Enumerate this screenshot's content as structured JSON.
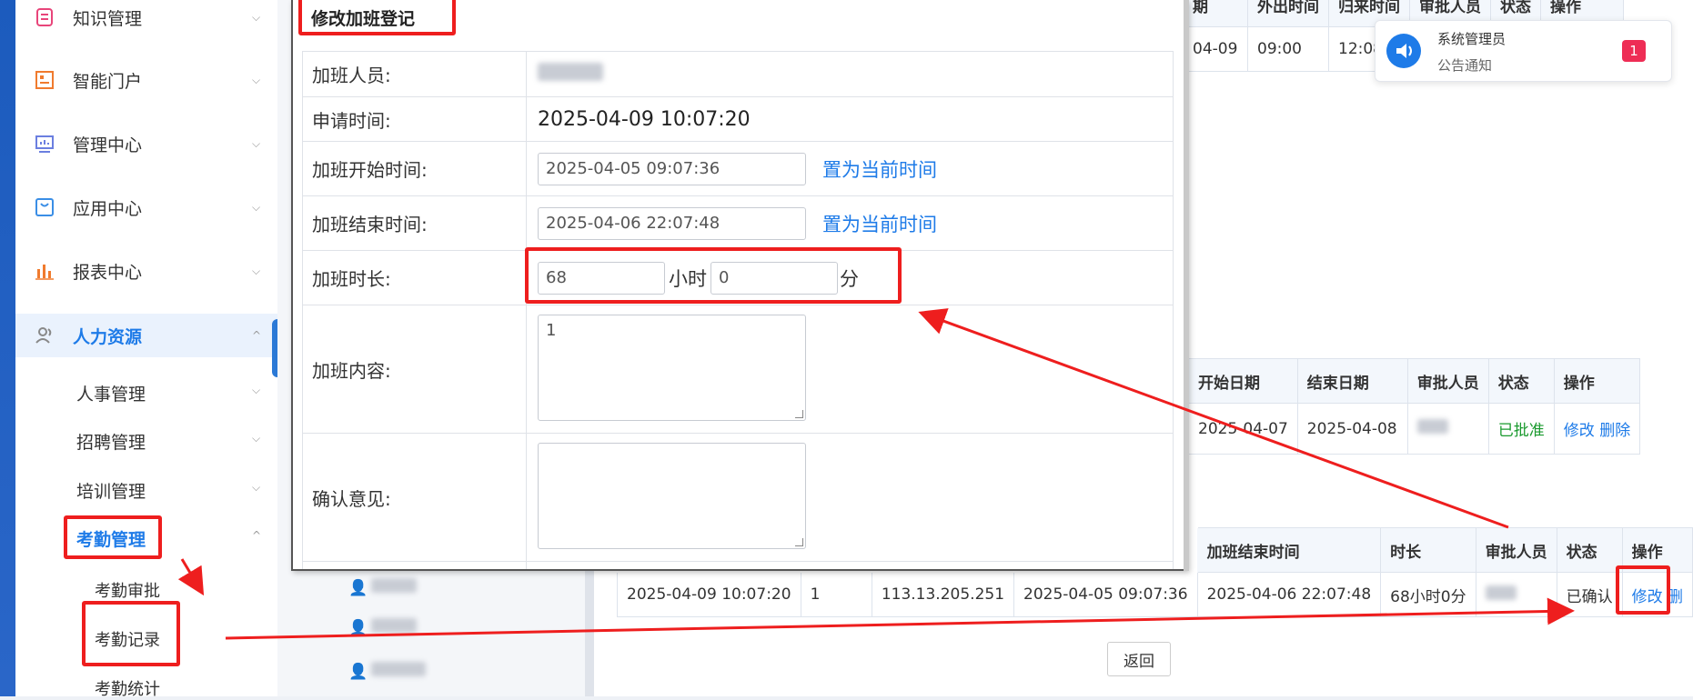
{
  "sidebar": {
    "items": [
      {
        "label": "知识管理",
        "icon": "list-icon",
        "color": "#e8457a"
      },
      {
        "label": "智能门户",
        "icon": "portal-icon",
        "color": "#f07b2e"
      },
      {
        "label": "管理中心",
        "icon": "monitor-chart-icon",
        "color": "#6b7fe0"
      },
      {
        "label": "应用中心",
        "icon": "app-box-icon",
        "color": "#3a8ee6"
      },
      {
        "label": "报表中心",
        "icon": "bar-chart-icon",
        "color": "#f07b2e"
      },
      {
        "label": "人力资源",
        "icon": "users-icon",
        "color": "#888888"
      }
    ],
    "hr_sub": [
      "人事管理",
      "招聘管理",
      "培训管理",
      "考勤管理"
    ],
    "attendance_sub": [
      "考勤审批",
      "考勤记录",
      "考勤统计"
    ]
  },
  "persons": [
    "沈浩",
    "吴浩",
    "黄河"
  ],
  "top_table": {
    "headers": [
      "期",
      "外出时间",
      "归来时间",
      "审批人员",
      "状态",
      "操作"
    ],
    "row": [
      "04-09",
      "09:00",
      "12:08"
    ]
  },
  "leave_table": {
    "headers": [
      "开始日期",
      "结束日期",
      "审批人员",
      "状态",
      "操作"
    ],
    "row": {
      "start": "2025-04-07",
      "end": "2025-04-08",
      "approver": "",
      "status": "已批准",
      "edit": "修改",
      "delete": "删除"
    }
  },
  "overtime_table": {
    "headers": [
      "加班结束时间",
      "时长",
      "审批人员",
      "状态",
      "操作"
    ],
    "row": {
      "apply_time": "2025-04-09 10:07:20",
      "content": "1",
      "ip": "113.13.205.251",
      "start": "2025-04-05 09:07:36",
      "end": "2025-04-06 22:07:48",
      "duration": "68小时0分",
      "approver": "",
      "status": "已确认",
      "edit": "修改",
      "delete": "删"
    }
  },
  "back_button": "返回",
  "notification": {
    "sender": "系统管理员",
    "type": "公告通知",
    "count": "1"
  },
  "modal": {
    "title": "修改加班登记",
    "person_label": "加班人员:",
    "person_value": "",
    "apply_label": "申请时间:",
    "apply_value": "2025-04-09 10:07:20",
    "start_label": "加班开始时间:",
    "start_value": "2025-04-05 09:07:36",
    "end_label": "加班结束时间:",
    "end_value": "2025-04-06 22:07:48",
    "set_now": "置为当前时间",
    "duration_label": "加班时长:",
    "hours_value": "68",
    "hours_unit": "小时",
    "minutes_value": "0",
    "minutes_unit": "分",
    "content_label": "加班内容:",
    "content_value": "1",
    "opinion_label": "确认意见:",
    "opinion_value": ""
  },
  "annotation_color": "#ee1e1e"
}
